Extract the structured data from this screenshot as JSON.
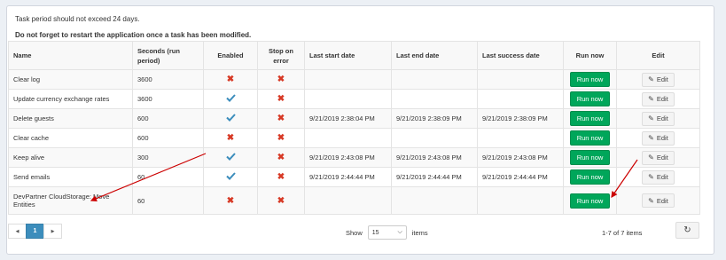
{
  "notes": {
    "line1": "Task period should not exceed 24 days.",
    "line2": "Do not forget to restart the application once a task has been modified."
  },
  "columns": {
    "name": "Name",
    "seconds": "Seconds (run period)",
    "enabled": "Enabled",
    "stop_on_error": "Stop on error",
    "last_start": "Last start date",
    "last_end": "Last end date",
    "last_success": "Last success date",
    "run_now": "Run now",
    "edit": "Edit"
  },
  "rows": [
    {
      "name": "Clear log",
      "seconds": "3600",
      "enabled": false,
      "stop_on_error": false,
      "last_start": "",
      "last_end": "",
      "last_success": ""
    },
    {
      "name": "Update currency exchange rates",
      "seconds": "3600",
      "enabled": true,
      "stop_on_error": false,
      "last_start": "",
      "last_end": "",
      "last_success": ""
    },
    {
      "name": "Delete guests",
      "seconds": "600",
      "enabled": true,
      "stop_on_error": false,
      "last_start": "9/21/2019 2:38:04 PM",
      "last_end": "9/21/2019 2:38:09 PM",
      "last_success": "9/21/2019 2:38:09 PM"
    },
    {
      "name": "Clear cache",
      "seconds": "600",
      "enabled": false,
      "stop_on_error": false,
      "last_start": "",
      "last_end": "",
      "last_success": ""
    },
    {
      "name": "Keep alive",
      "seconds": "300",
      "enabled": true,
      "stop_on_error": false,
      "last_start": "9/21/2019 2:43:08 PM",
      "last_end": "9/21/2019 2:43:08 PM",
      "last_success": "9/21/2019 2:43:08 PM"
    },
    {
      "name": "Send emails",
      "seconds": "60",
      "enabled": true,
      "stop_on_error": false,
      "last_start": "9/21/2019 2:44:44 PM",
      "last_end": "9/21/2019 2:44:44 PM",
      "last_success": "9/21/2019 2:44:44 PM"
    },
    {
      "name": "DevPartner CloudStorage: Move Entities",
      "seconds": "60",
      "enabled": false,
      "stop_on_error": false,
      "last_start": "",
      "last_end": "",
      "last_success": ""
    }
  ],
  "buttons": {
    "run_now": "Run now",
    "edit": "Edit"
  },
  "pager": {
    "prev": "◀",
    "current": "1",
    "next": "▶"
  },
  "page_size": {
    "show_label": "Show",
    "value": "15",
    "items_label": "items"
  },
  "range_text": "1-7 of 7 items",
  "icons": {
    "enabled": "check-icon",
    "disabled": "x-icon",
    "edit": "pencil-icon",
    "refresh": "refresh-icon"
  },
  "colors": {
    "run_button": "#00a65a",
    "check": "#3c8dbc",
    "cross": "#d73925",
    "annotation_arrow": "#cc0000",
    "pager_active": "#3c8dbc"
  }
}
